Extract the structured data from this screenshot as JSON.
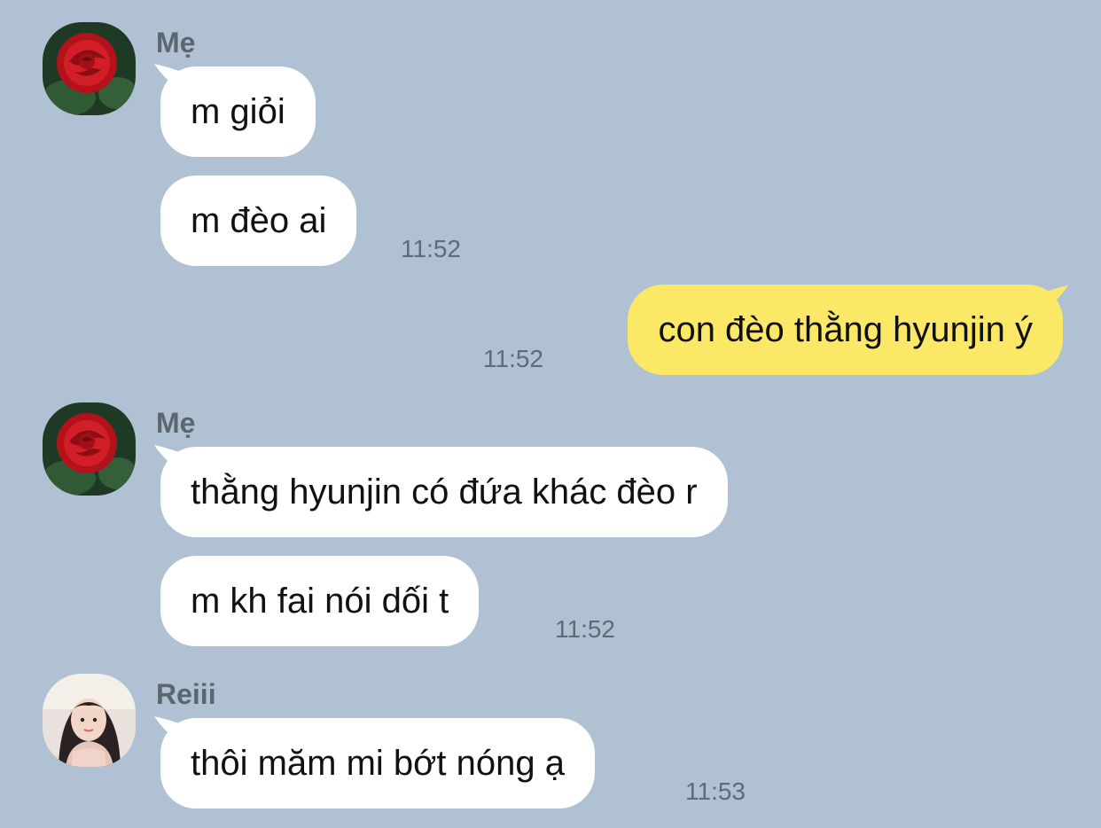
{
  "messages": [
    {
      "sender": "Mẹ",
      "avatar": "rose-avatar",
      "bubbles": [
        "m giỏi",
        "m đèo ai"
      ],
      "time": "11:52"
    },
    {
      "sender": "me",
      "bubbles": [
        "con đèo thằng hyunjin ý"
      ],
      "time": "11:52"
    },
    {
      "sender": "Mẹ",
      "avatar": "rose-avatar",
      "bubbles": [
        "thằng hyunjin có đứa khác đèo r",
        "m kh fai nói dối t"
      ],
      "time": "11:52"
    },
    {
      "sender": "Reiii",
      "avatar": "girl-photo-avatar",
      "bubbles": [
        "thôi măm mi bớt nóng ạ"
      ],
      "time": "11:53"
    }
  ],
  "colors": {
    "background": "#afc1d2",
    "incoming_bubble": "#ffffff",
    "outgoing_bubble": "#fbe867",
    "timestamp": "#5f6b77",
    "sender_name": "#5d6670"
  }
}
